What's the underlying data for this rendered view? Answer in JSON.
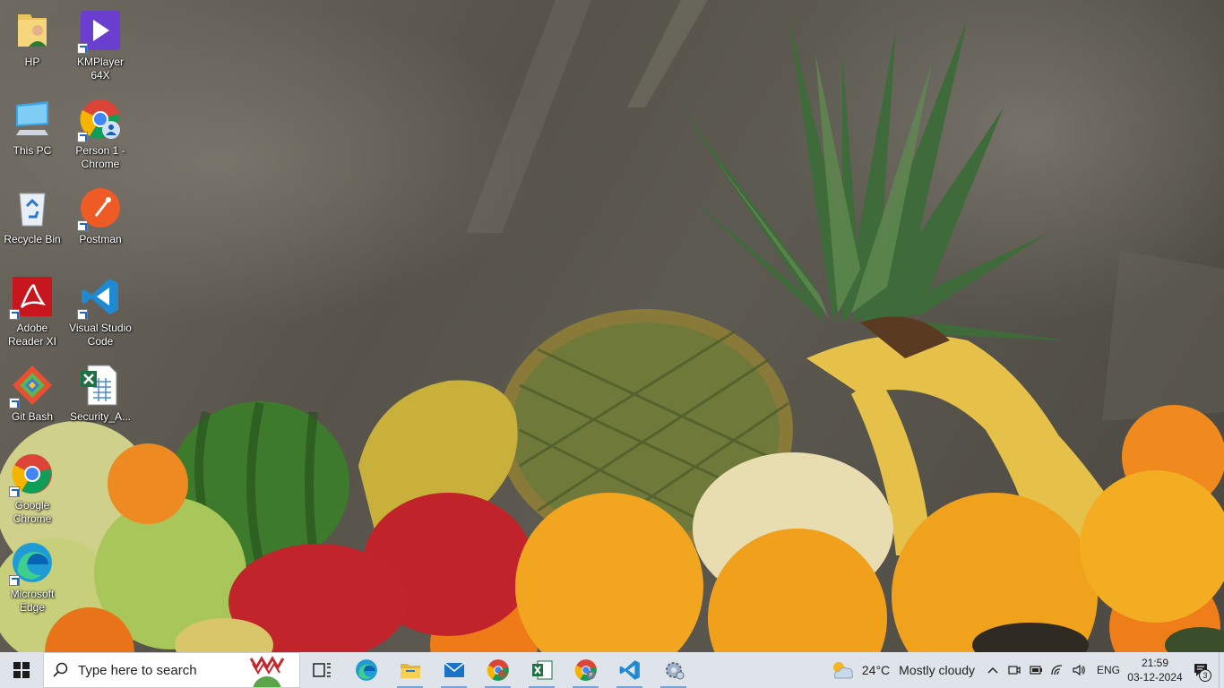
{
  "desktop": {
    "icons": [
      {
        "label": "HP",
        "icon": "user-folder-icon"
      },
      {
        "label": "KMPlayer 64X",
        "icon": "kmplayer-icon"
      },
      {
        "label": "This PC",
        "icon": "this-pc-icon"
      },
      {
        "label": "Person 1 - Chrome",
        "icon": "chrome-profile-icon"
      },
      {
        "label": "Recycle Bin",
        "icon": "recycle-bin-icon"
      },
      {
        "label": "Postman",
        "icon": "postman-icon"
      },
      {
        "label": "Adobe Reader XI",
        "icon": "adobe-reader-icon"
      },
      {
        "label": "Visual Studio Code",
        "icon": "vscode-icon"
      },
      {
        "label": "Git Bash",
        "icon": "git-bash-icon"
      },
      {
        "label": "Security_A...",
        "icon": "excel-file-icon"
      },
      {
        "label": "Google Chrome",
        "icon": "chrome-icon"
      },
      {
        "label": "Microsoft Edge",
        "icon": "edge-icon"
      }
    ]
  },
  "taskbar": {
    "search_placeholder": "Type here to search",
    "apps": [
      {
        "name": "Task View",
        "icon": "task-view-icon"
      },
      {
        "name": "Microsoft Edge",
        "icon": "edge-icon"
      },
      {
        "name": "File Explorer",
        "icon": "file-explorer-icon"
      },
      {
        "name": "Mail",
        "icon": "mail-icon"
      },
      {
        "name": "Google Chrome",
        "icon": "chrome-icon"
      },
      {
        "name": "Excel",
        "icon": "excel-icon"
      },
      {
        "name": "Chrome Profile",
        "icon": "chrome-profile-icon"
      },
      {
        "name": "Visual Studio Code",
        "icon": "vscode-icon"
      },
      {
        "name": "Control Panel",
        "icon": "settings-icon"
      }
    ],
    "weather": {
      "temp": "24°C",
      "desc": "Mostly cloudy",
      "icon": "cloudy-sun-icon"
    },
    "language": "ENG",
    "clock": {
      "time": "21:59",
      "date": "03-12-2024"
    },
    "notification_count": "3"
  },
  "colors": {
    "taskbar_bg": "#dfe3ea",
    "accent": "#1f66c9"
  }
}
